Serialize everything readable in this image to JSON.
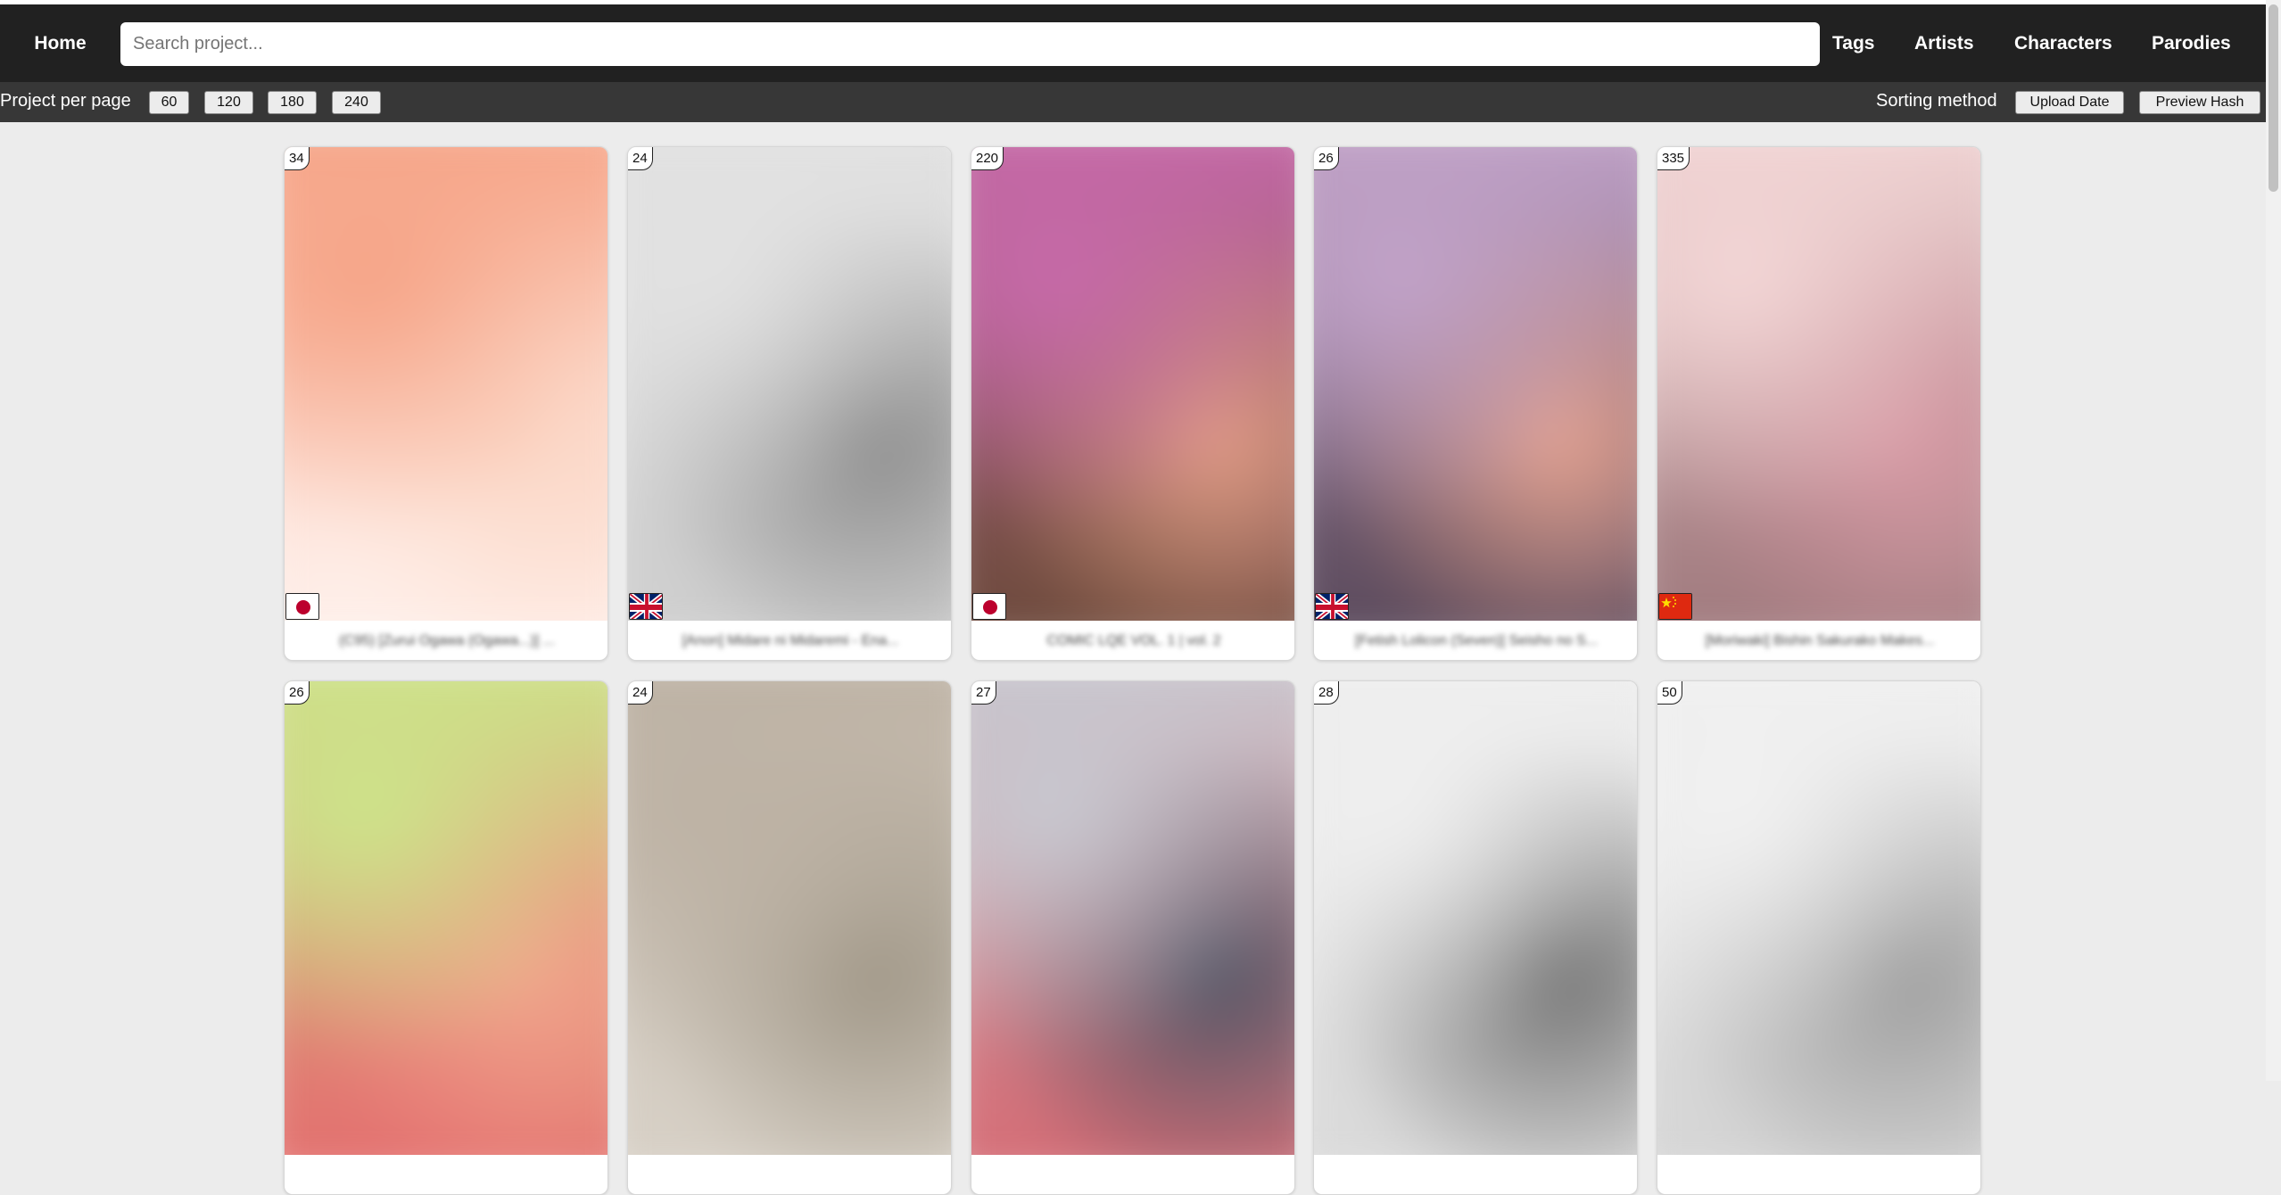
{
  "navbar": {
    "home_label": "Home",
    "search_placeholder": "Search project...",
    "links": [
      "Tags",
      "Artists",
      "Characters",
      "Parodies"
    ]
  },
  "toolbar": {
    "per_page_label": "Project per page",
    "per_page_options": [
      "60",
      "120",
      "180",
      "240"
    ],
    "sort_label": "Sorting method",
    "sort_options": [
      "Upload Date",
      "Preview Hash"
    ]
  },
  "cards": [
    {
      "count": "34",
      "flag": "japan-flag-icon",
      "title": "(C95) [Zurui Ogawa (Ogawa...)] ...",
      "colors": [
        "#f6a487",
        "#fbd7c6",
        "#fff1ec"
      ]
    },
    {
      "count": "24",
      "flag": "uk-flag-icon",
      "title": "[Anon] Midare ni Midaremi - Ena...",
      "colors": [
        "#e2e2e2",
        "#8a8a8a",
        "#cfcfcf"
      ]
    },
    {
      "count": "220",
      "flag": "japan-flag-icon",
      "title": "COMIC LQE VOL. 1 | vol. 2",
      "colors": [
        "#c76aa9",
        "#e39f86",
        "#6d4a3c"
      ]
    },
    {
      "count": "26",
      "flag": "uk-flag-icon",
      "title": "[Fetish Lolicon (Seven)] Seisho no S...",
      "colors": [
        "#c2a3c9",
        "#e6a38f",
        "#5b4a5c"
      ]
    },
    {
      "count": "335",
      "flag": "china-flag-icon",
      "title": "[Moriwaki] Bishin Sakurako Makes...",
      "colors": [
        "#f3d6d6",
        "#d89aa5",
        "#a07a7e"
      ]
    },
    {
      "count": "26",
      "flag": "",
      "title": "",
      "colors": [
        "#cde48a",
        "#f2a48c",
        "#e36f6f"
      ]
    },
    {
      "count": "24",
      "flag": "",
      "title": "",
      "colors": [
        "#bdb2a4",
        "#9e9585",
        "#d8d1c7"
      ]
    },
    {
      "count": "27",
      "flag": "",
      "title": "",
      "colors": [
        "#c8c8d0",
        "#4f5363",
        "#d56d76"
      ]
    },
    {
      "count": "28",
      "flag": "",
      "title": "",
      "colors": [
        "#efefef",
        "#6f6f6f",
        "#dadada"
      ]
    },
    {
      "count": "50",
      "flag": "",
      "title": "",
      "colors": [
        "#f1f1f1",
        "#9a9a9a",
        "#d5d5d5"
      ]
    }
  ]
}
